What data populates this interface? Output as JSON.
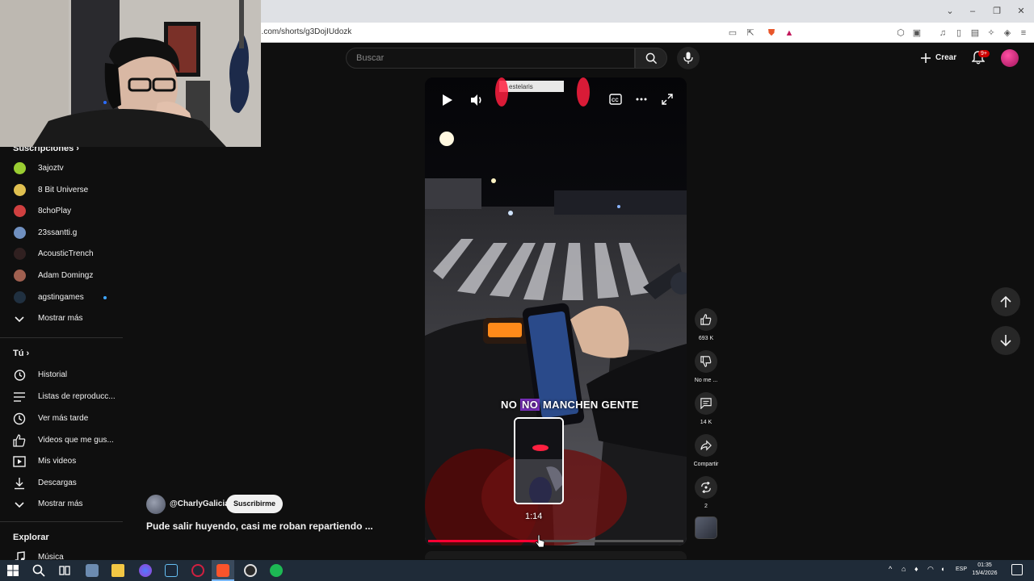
{
  "browser": {
    "url": "e.com/shorts/g3DojIUdozk"
  },
  "header": {
    "search_placeholder": "Buscar",
    "create_label": "Crear",
    "notifications_badge": "9+"
  },
  "sidebar": {
    "subscriptions_title": "Suscripciones",
    "subscriptions": [
      {
        "label": "3ajoztv",
        "color": "#9acd32"
      },
      {
        "label": "8 Bit Universe",
        "color": "#e0c050"
      },
      {
        "label": "8choPlay",
        "color": "#d04040"
      },
      {
        "label": "23ssantti.g",
        "color": "#7090c0"
      },
      {
        "label": "AcousticTrench",
        "color": "#302020"
      },
      {
        "label": "Adam Domingz",
        "color": "#a06050"
      },
      {
        "label": "agstingames",
        "color": "#203040"
      }
    ],
    "show_more_1": "Mostrar más",
    "you_title": "Tú",
    "you_items": [
      {
        "label": "Historial",
        "icon": "history-icon"
      },
      {
        "label": "Listas de reproducc...",
        "icon": "playlists-icon"
      },
      {
        "label": "Ver más tarde",
        "icon": "clock-icon"
      },
      {
        "label": "Videos que me gus...",
        "icon": "thumb-up-icon"
      },
      {
        "label": "Mis videos",
        "icon": "video-icon"
      },
      {
        "label": "Descargas",
        "icon": "download-icon"
      }
    ],
    "show_more_2": "Mostrar más",
    "explore_title": "Explorar",
    "explore_items": [
      {
        "label": "Música",
        "icon": "music-icon"
      }
    ]
  },
  "video": {
    "caption_part1": "NO ",
    "caption_highlight": "NO",
    "caption_part2": " MANCHEN GENTE",
    "scrub_time": "1:14",
    "progress": 0.43,
    "sign_text": "estelaris",
    "channel_handle": "@CharlyGalicia",
    "subscribe_label": "Suscribirme",
    "title": "Pude salir huyendo, casi me roban repartiendo ..."
  },
  "actions": {
    "likes": "693 K",
    "dislike_label": "No me ...",
    "comments": "14 K",
    "share_label": "Compartir",
    "remix_count": "2"
  },
  "taskbar": {
    "lang": "ESP",
    "time": "01:35",
    "date": "15/4/2026"
  }
}
